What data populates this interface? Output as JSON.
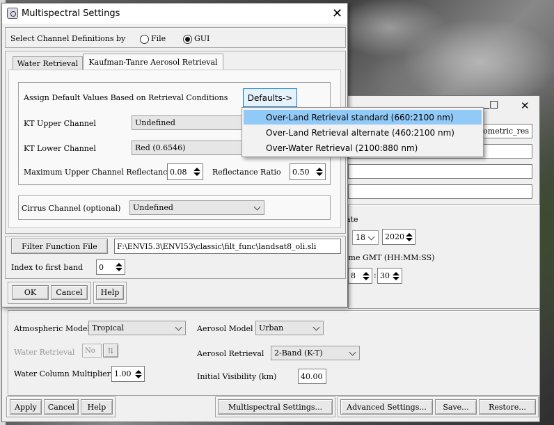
{
  "background_window": {
    "title_partial": "ometric_res",
    "window_controls": {
      "minimize": "—",
      "maximize": "☐",
      "close": "✕"
    },
    "date_label_partial": "ate",
    "day_value": "18",
    "year_value": "2020",
    "time_label_partial": "ime GMT (HH:MM:SS)",
    "time_partial_hour": "8",
    "time_separator": ":",
    "time_minutes": "30",
    "atmospheric_model_label": "Atmospheric Model",
    "atmospheric_model_value": "Tropical",
    "aerosol_model_label": "Aerosol Model",
    "aerosol_model_value": "Urban",
    "water_retrieval_label": "Water Retrieval",
    "water_retrieval_value": "No",
    "aerosol_retrieval_label": "Aerosol Retrieval",
    "aerosol_retrieval_value": "2-Band (K-T)",
    "water_column_label": "Water Column Multiplier",
    "water_column_value": "1.00",
    "initial_visibility_label": "Initial Visibility (km)",
    "initial_visibility_value": "40.00",
    "buttons": {
      "apply": "Apply",
      "cancel": "Cancel",
      "help": "Help",
      "multispectral": "Multispectral Settings...",
      "advanced": "Advanced Settings...",
      "save": "Save...",
      "restore": "Restore..."
    }
  },
  "multispectral": {
    "title": "Multispectral Settings",
    "close_glyph": "✕",
    "select_label": "Select Channel Definitions by",
    "radio_file": "File",
    "radio_gui": "GUI",
    "tabs": [
      "Water Retrieval",
      "Kaufman-Tanre Aerosol Retrieval"
    ],
    "assign_label": "Assign Default Values Based on Retrieval Conditions",
    "defaults_button": "Defaults->",
    "kt_upper_label": "KT Upper Channel",
    "kt_upper_value": "Undefined",
    "kt_lower_label": "KT Lower Channel",
    "kt_lower_value": "Red (0.6546)",
    "max_upper_label": "Maximum Upper Channel Reflectance",
    "max_upper_value": "0.08",
    "reflectance_ratio_label": "Reflectance Ratio",
    "reflectance_ratio_value": "0.50",
    "cirrus_label": "Cirrus Channel (optional)",
    "cirrus_value": "Undefined",
    "filter_button": "Filter Function File",
    "filter_path": "F:\\ENVI5.3\\ENVI53\\classic\\filt_func\\landsat8_oli.sli",
    "index_label": "Index to first band",
    "index_value": "0",
    "ok": "OK",
    "cancel": "Cancel",
    "help": "Help"
  },
  "defaults_menu": {
    "items": [
      "Over-Land Retrieval standard (660:2100 nm)",
      "Over-Land Retrieval alternate (460:2100 nm)",
      "Over-Water Retrieval (2100:880 nm)"
    ],
    "highlighted_index": 0
  },
  "colors": {
    "menu_highlight": "#91c9f7",
    "window_bg": "#f0f0f0",
    "defaults_button_bg": "#e5f1fb",
    "defaults_button_border": "#0078d7"
  }
}
